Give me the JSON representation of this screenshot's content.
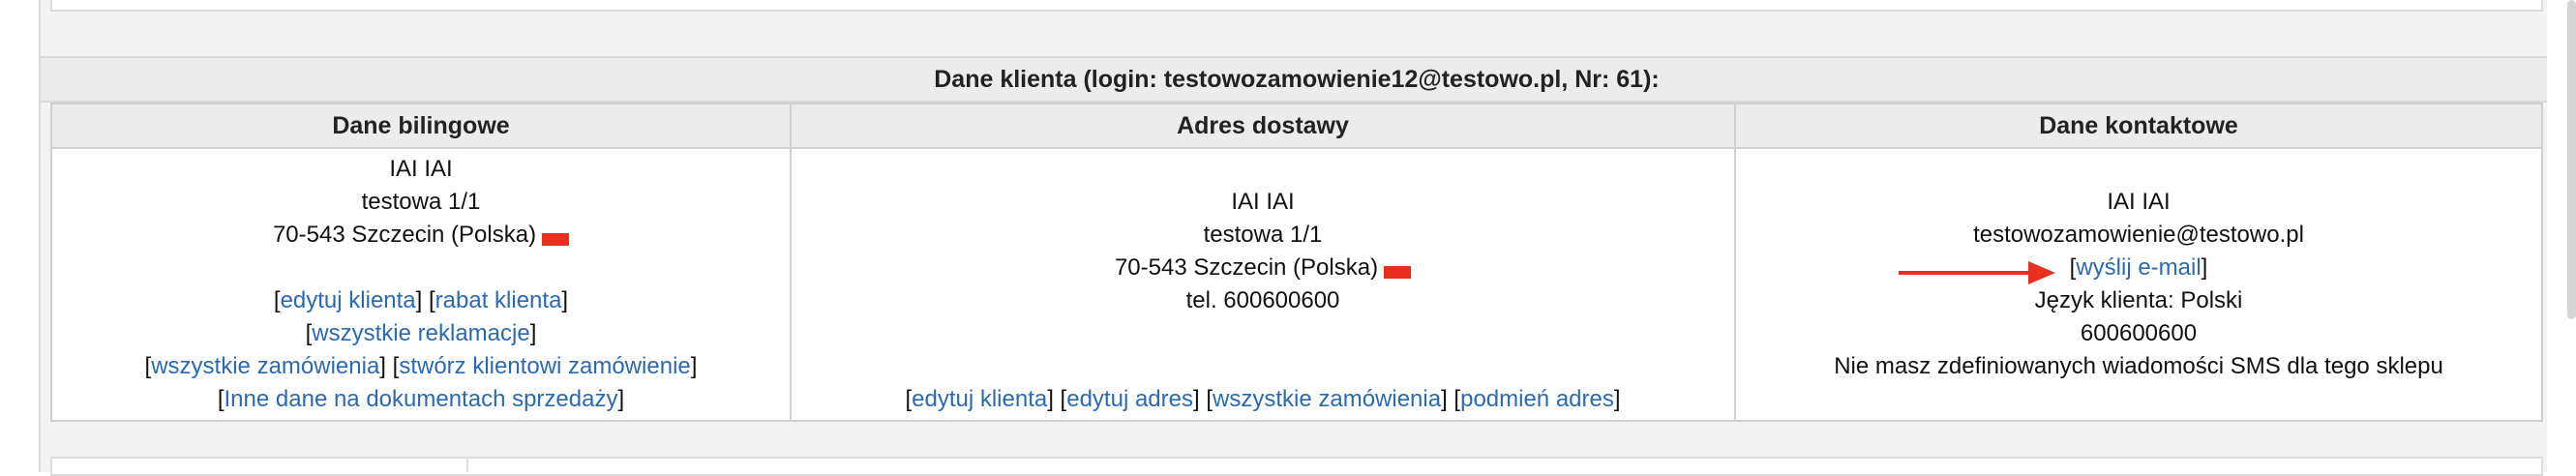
{
  "header": {
    "title": "Dane klienta (login: testowozamowienie12@testowo.pl, Nr: 61):"
  },
  "top_clip": "[ ... ] [ ... ]",
  "billing": {
    "title": "Dane bilingowe",
    "name": "IAI IAI",
    "street": "testowa 1/1",
    "city": "70-543 Szczecin (Polska)",
    "links": {
      "edit_client": "edytuj klienta",
      "client_discount": "rabat klienta",
      "all_complaints": "wszystkie reklamacje",
      "all_orders": "wszystkie zamówienia",
      "create_order": "stwórz klientowi zamówienie",
      "other_docs": "Inne dane na dokumentach sprzedaży"
    }
  },
  "shipping": {
    "title": "Adres dostawy",
    "name": "IAI IAI",
    "street": "testowa 1/1",
    "city": "70-543 Szczecin (Polska)",
    "phone": "tel. 600600600",
    "links": {
      "edit_client": "edytuj klienta",
      "edit_address": "edytuj adres",
      "all_orders": "wszystkie zamówienia",
      "replace_address": "podmień adres"
    }
  },
  "contact": {
    "title": "Dane kontaktowe",
    "name": "IAI IAI",
    "email": "testowozamowienie@testowo.pl",
    "send_email": "wyślij e-mail",
    "language": "Język klienta: Polski",
    "phone": "600600600",
    "sms_note": "Nie masz zdefiniowanych wiadomości SMS dla tego sklepu"
  },
  "colors": {
    "link": "#2a6ab5",
    "flag": "#e8301e",
    "arrow": "#e8301e"
  }
}
